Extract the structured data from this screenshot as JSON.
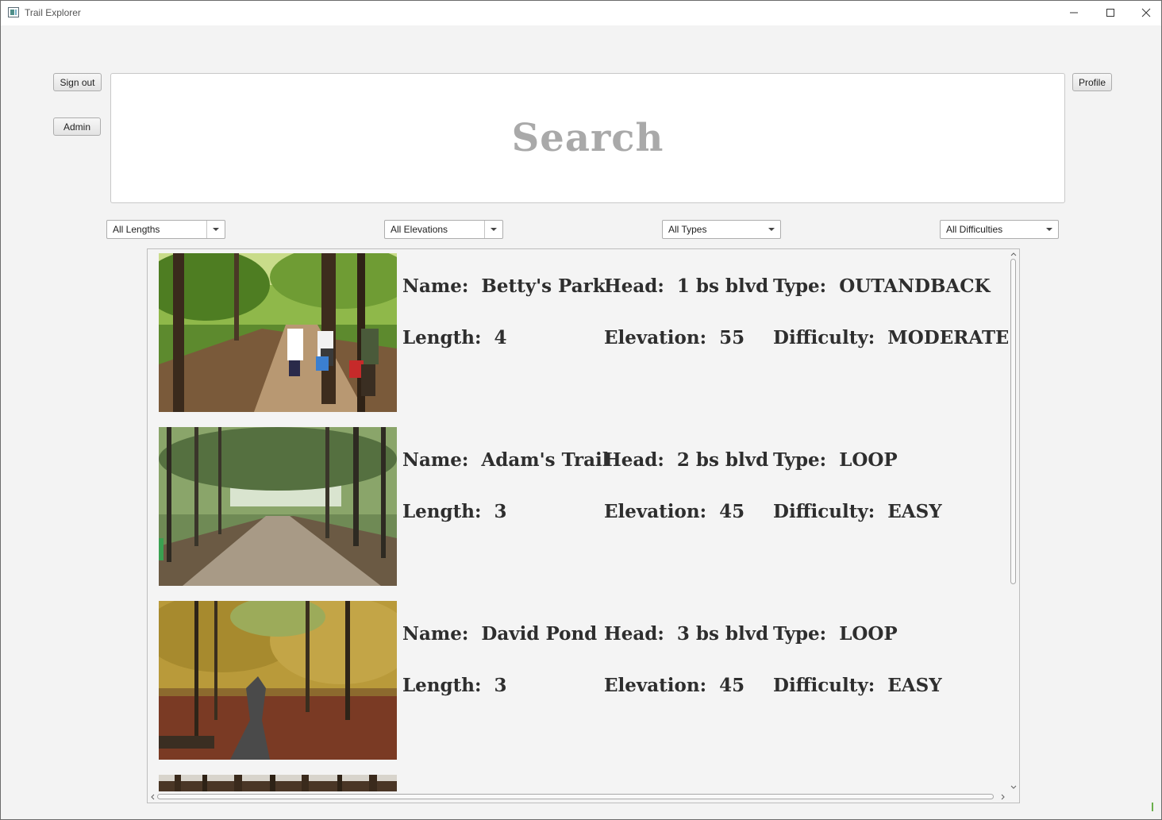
{
  "window": {
    "title": "Trail Explorer"
  },
  "titlebar_icons": [
    "minimize-icon",
    "maximize-icon",
    "close-icon"
  ],
  "buttons": {
    "sign_out": "Sign out",
    "admin": "Admin",
    "profile": "Profile"
  },
  "search": {
    "placeholder": "Search"
  },
  "filters": {
    "length": "All Lengths",
    "elevation": "All Elevations",
    "type": "All Types",
    "difficulty": "All Difficulties"
  },
  "labels": {
    "name": "Name:",
    "head": "Head:",
    "type": "Type:",
    "length": "Length:",
    "elevation": "Elevation:",
    "difficulty": "Difficulty:"
  },
  "trails": [
    {
      "name": "Betty's Park",
      "head": "1 bs blvd",
      "type": "OUTANDBACK",
      "length": "4",
      "elevation": "55",
      "difficulty": "MODERATE",
      "image": "hikers-on-forest-trail"
    },
    {
      "name": "Adam's Trail",
      "head": "2 bs blvd",
      "type": "LOOP",
      "length": "3",
      "elevation": "45",
      "difficulty": "EASY",
      "image": "leafy-forest-path"
    },
    {
      "name": "David Pond",
      "head": "3 bs blvd",
      "type": "LOOP",
      "length": "3",
      "elevation": "45",
      "difficulty": "EASY",
      "image": "autumn-forest-path"
    }
  ],
  "colors": {
    "window_bg": "#f3f3f3",
    "search_placeholder": "#a9a9a9",
    "text": "#2e2e2e"
  }
}
